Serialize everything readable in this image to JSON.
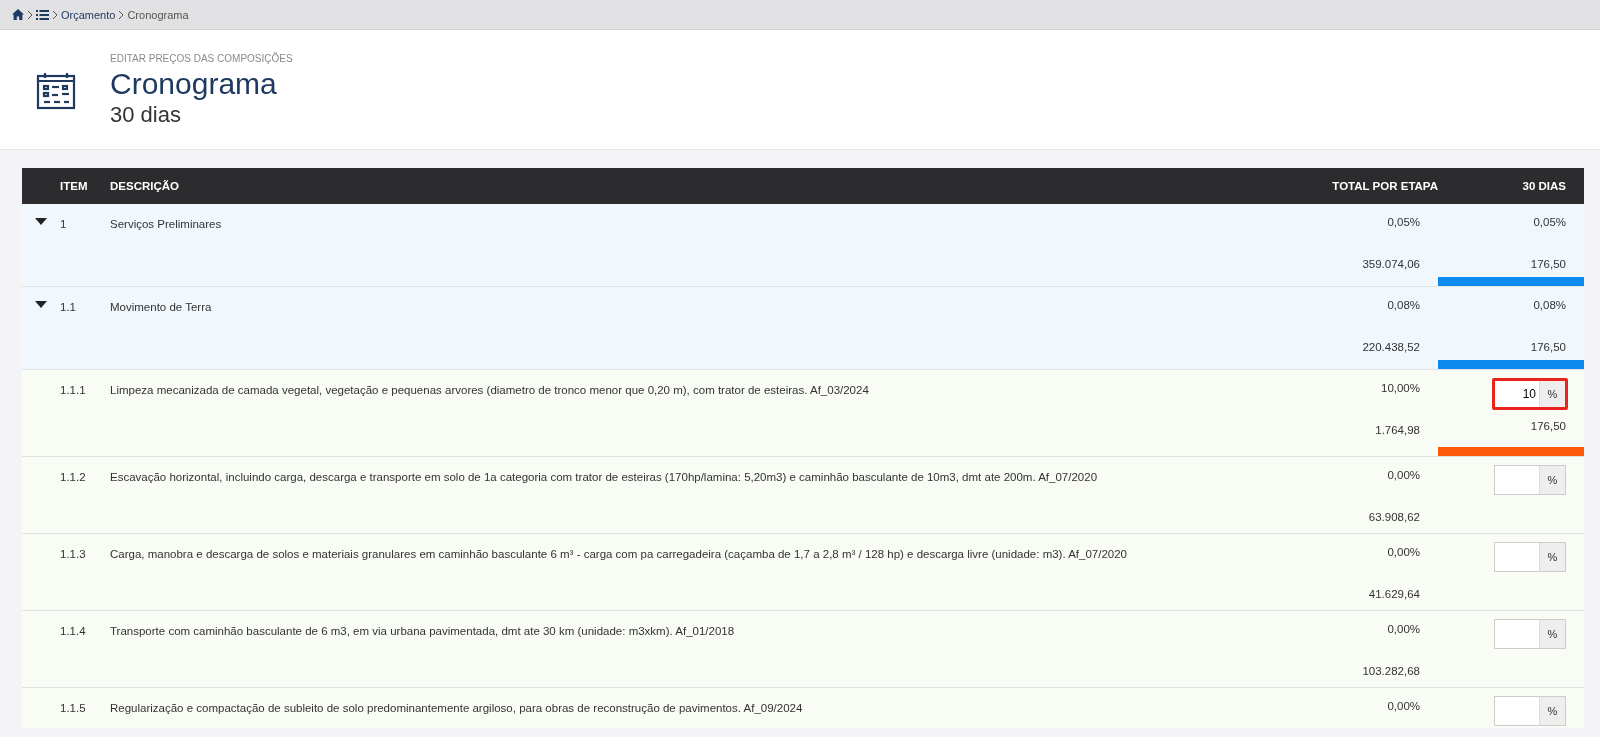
{
  "breadcrumb": {
    "items": [
      {
        "kind": "home"
      },
      {
        "kind": "list"
      },
      {
        "kind": "link",
        "label": "Orçamento"
      },
      {
        "kind": "current",
        "label": "Cronograma"
      }
    ]
  },
  "header": {
    "overline": "EDITAR PREÇOS DAS COMPOSIÇÕES",
    "title": "Cronograma",
    "subtitle": "30 dias"
  },
  "table": {
    "columns": [
      "ITEM",
      "DESCRIÇÃO",
      "TOTAL POR ETAPA",
      "30 DIAS"
    ],
    "rows": [
      {
        "kind": "group",
        "expanded": true,
        "item": "1",
        "description": "Serviços Preliminares",
        "total_percent": "0,05%",
        "total_value": "359.074,06",
        "day_percent": "0,05%",
        "day_value": "176,50",
        "color": "#0d8af0"
      },
      {
        "kind": "group",
        "expanded": true,
        "item": "1.1",
        "description": "Movimento de Terra",
        "total_percent": "0,08%",
        "total_value": "220.438,52",
        "day_percent": "0,08%",
        "day_value": "176,50",
        "color": "#0d8af0"
      },
      {
        "kind": "item",
        "item": "1.1.1",
        "description": "Limpeza mecanizada de camada vegetal, vegetação e pequenas arvores (diametro de tronco menor que 0,20 m), com trator de esteiras. Af_03/2024",
        "total_percent": "10,00%",
        "total_value": "1.764,98",
        "input": {
          "value": "10",
          "unit": "%",
          "selected": true
        },
        "day_value": "176,50",
        "color": "#ff5a0a"
      },
      {
        "kind": "item",
        "item": "1.1.2",
        "description": "Escavação horizontal, incluindo carga, descarga e transporte em solo de 1a categoria com trator de esteiras (170hp/lamina: 5,20m3) e caminhão basculante de 10m3, dmt ate 200m. Af_07/2020",
        "total_percent": "0,00%",
        "total_value": "63.908,62",
        "input": {
          "unit": "%",
          "selected": false
        }
      },
      {
        "kind": "item",
        "item": "1.1.3",
        "description": "Carga, manobra e descarga de solos e materiais granulares em caminhão basculante 6 m³ - carga com pa carregadeira (caçamba de 1,7 a 2,8 m³ / 128 hp) e descarga livre (unidade: m3). Af_07/2020",
        "total_percent": "0,00%",
        "total_value": "41.629,64",
        "input": {
          "unit": "%",
          "selected": false
        }
      },
      {
        "kind": "item",
        "item": "1.1.4",
        "description": "Transporte com caminhão basculante de 6 m3, em via urbana pavimentada, dmt ate 30 km (unidade: m3xkm). Af_01/2018",
        "total_percent": "0,00%",
        "total_value": "103.282,68",
        "input": {
          "unit": "%",
          "selected": false
        }
      },
      {
        "kind": "item",
        "item": "1.1.5",
        "description": "Regularização e compactação de subleito de solo predominantemente argiloso, para obras de reconstrução de pavimentos. Af_09/2024",
        "total_percent": "0,00%",
        "input": {
          "unit": "%",
          "selected": false
        }
      }
    ]
  }
}
